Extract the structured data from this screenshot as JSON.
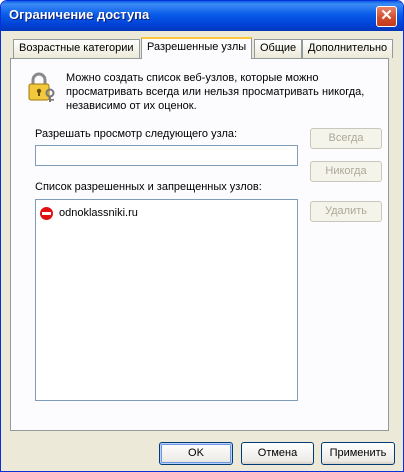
{
  "window": {
    "title": "Ограничение доступа",
    "close_glyph": "✕"
  },
  "tabs": [
    {
      "label": "Возрастные категории"
    },
    {
      "label": "Разрешенные узлы"
    },
    {
      "label": "Общие"
    },
    {
      "label": "Дополнительно"
    }
  ],
  "active_tab": "Разрешенные узлы",
  "info": {
    "icon": "lock-keys-icon",
    "text": "Можно создать список веб-узлов, которые можно просматривать всегда или нельзя просматривать никогда, независимо от их оценок."
  },
  "allow": {
    "label": "Разрешать просмотр следующего узла:",
    "value": ""
  },
  "list": {
    "label": "Список разрешенных и запрещенных узлов:",
    "items": [
      {
        "site": "odnoklassniki.ru",
        "status": "never",
        "icon": "deny-icon"
      }
    ]
  },
  "side_buttons": {
    "always": "Всегда",
    "never": "Никогда",
    "delete": "Удалить"
  },
  "footer": {
    "ok": "OK",
    "cancel": "Отмена",
    "apply": "Применить"
  }
}
